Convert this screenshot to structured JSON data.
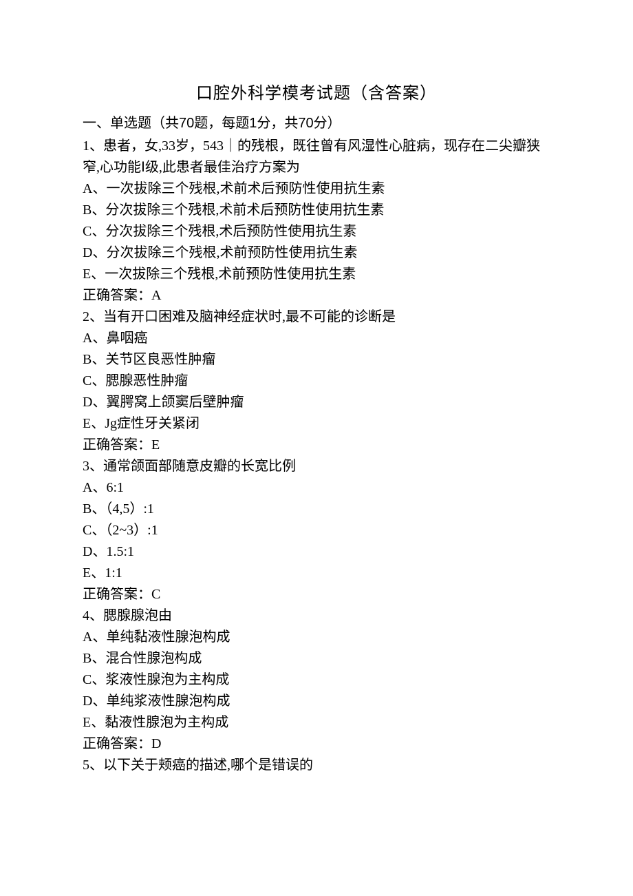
{
  "title": "口腔外科学模考试题（含答案）",
  "section": {
    "label_prefix": "一、单选题（共",
    "count1": "70",
    "mid1": "题，每题",
    "per": "1",
    "mid2": "分，共",
    "total": "70",
    "suffix": "分）"
  },
  "answer_label": "正确答案：",
  "questions": [
    {
      "num": "1",
      "stem": "患者，女,33岁，543｜的残根，既往曾有风湿性心脏病，现存在二尖瓣狭窄,心功能Ⅰ级,此患者最佳治疗方案为",
      "options": {
        "A": "一次拔除三个残根,术前术后预防性使用抗生素",
        "B": "分次拔除三个残根,术前术后预防性使用抗生素",
        "C": "分次拔除三个残根,术后预防性使用抗生素",
        "D": "分次拔除三个残根,术前预防性使用抗生素",
        "E": "一次拔除三个残根,术前预防性使用抗生素"
      },
      "answer": "A"
    },
    {
      "num": "2",
      "stem": "当有开口困难及脑神经症状时,最不可能的诊断是",
      "options": {
        "A": "鼻咽癌",
        "B": "关节区良恶性肿瘤",
        "C": "腮腺恶性肿瘤",
        "D": "翼腭窝上颌窦后壁肿瘤",
        "E": "Jg症性牙关紧闭"
      },
      "answer": "E"
    },
    {
      "num": "3",
      "stem": "通常颌面部随意皮瓣的长宽比例",
      "options": {
        "A": "6:1",
        "B": "（4,5）:1",
        "C": "（2~3）:1",
        "D": "1.5:1",
        "E": "1:1"
      },
      "answer": "C"
    },
    {
      "num": "4",
      "stem": "腮腺腺泡由",
      "options": {
        "A": "单纯黏液性腺泡构成",
        "B": "混合性腺泡构成",
        "C": "浆液性腺泡为主构成",
        "D": "单纯浆液性腺泡构成",
        "E": "黏液性腺泡为主构成"
      },
      "answer": "D"
    },
    {
      "num": "5",
      "stem": "以下关于颊癌的描述,哪个是错误的",
      "options": {},
      "answer": ""
    }
  ]
}
